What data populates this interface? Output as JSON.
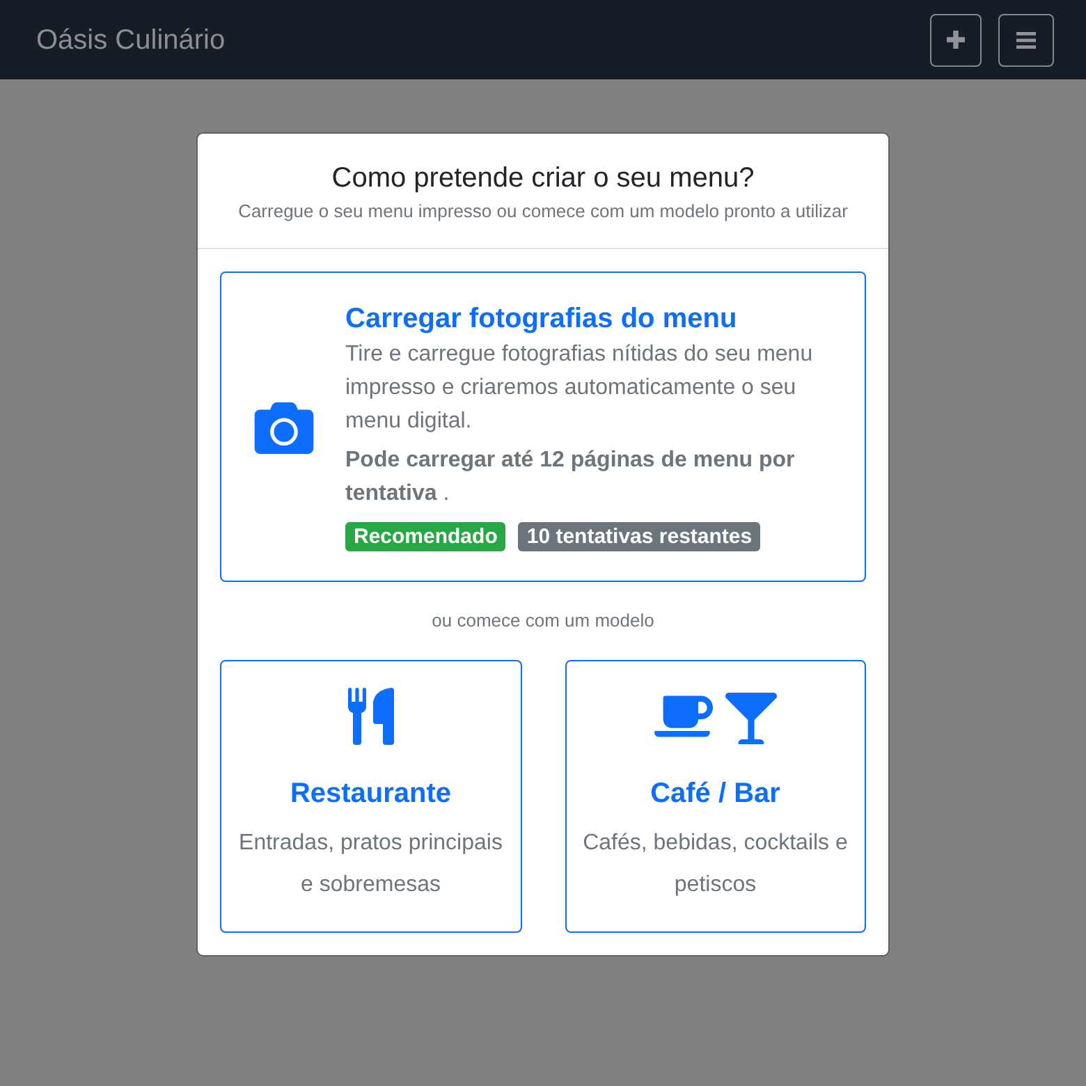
{
  "navbar": {
    "brand": "Oásis Culinário",
    "buttons": [
      {
        "kind": "add"
      },
      {
        "kind": "menu"
      }
    ]
  },
  "modal": {
    "title": "Como pretende criar o seu menu?",
    "subtitle": "Carregue o seu menu impresso ou comece com um modelo pronto a utilizar",
    "upload_option": {
      "title": "Carregar fotografias do menu",
      "description": "Tire e carregue fotografias nítidas do seu menu impresso e criaremos automaticamente o seu menu digital.",
      "note": "**Pode carregar até 12 páginas de menu por tentativa** .",
      "badges": [
        {
          "label": "Recomendado",
          "color": "#28a745"
        },
        {
          "label": "10 tentativas restantes",
          "color": "#6c757d"
        }
      ]
    },
    "divider": "ou comece com um modelo",
    "templates": [
      {
        "kind": "restaurant",
        "title": "Restaurante",
        "description": "Entradas, pratos principais e sobremesas"
      },
      {
        "kind": "cafe_bar",
        "title": "Café / Bar",
        "description": "Cafés, bebidas, cocktails e petiscos"
      }
    ]
  }
}
